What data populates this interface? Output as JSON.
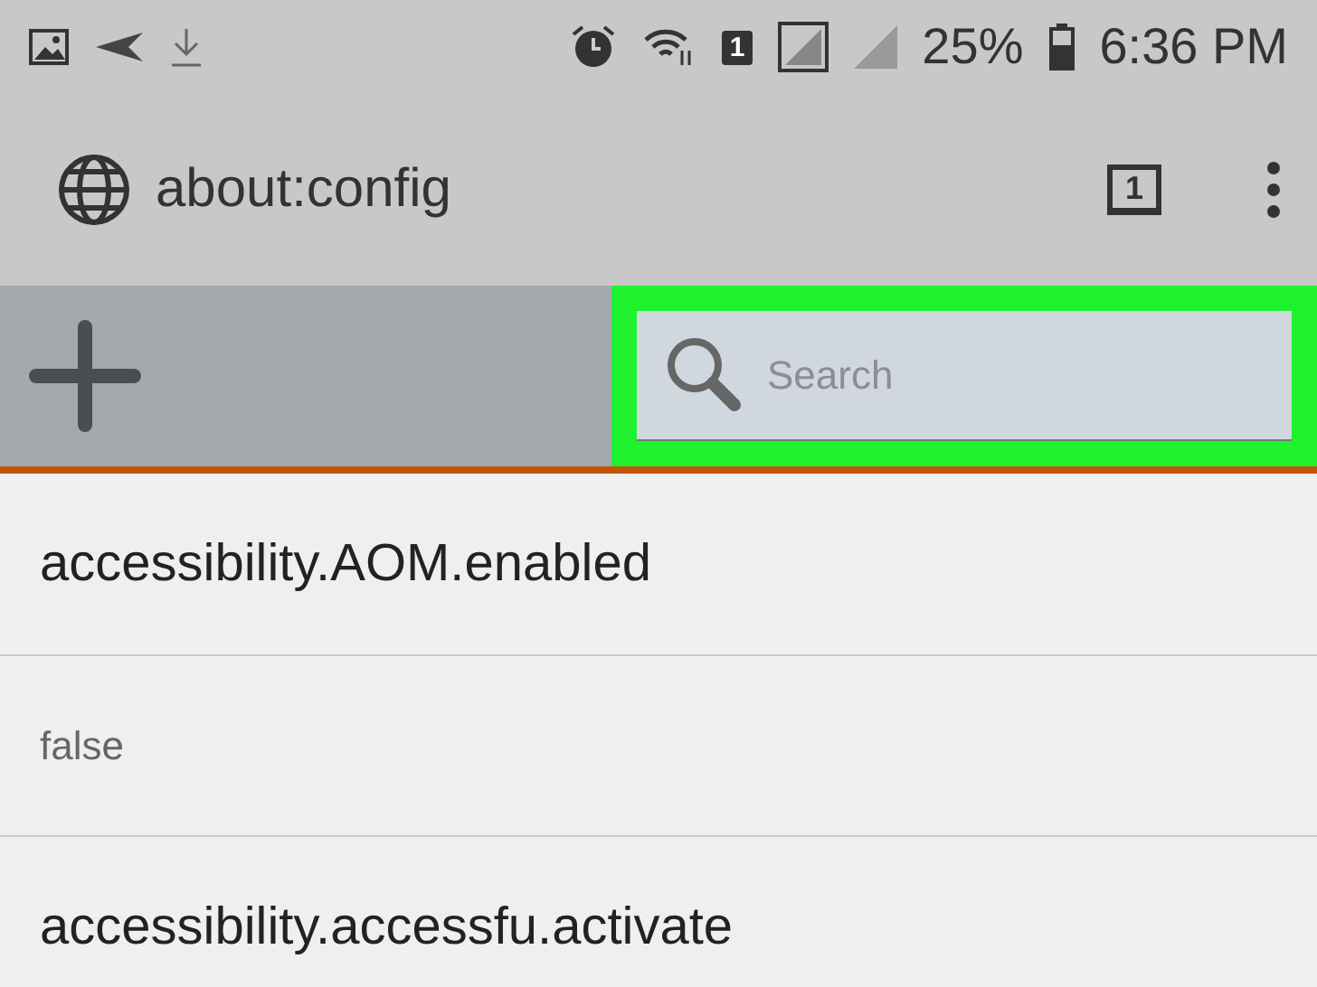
{
  "status_bar": {
    "sim_slot": "1",
    "battery": "25%",
    "time": "6:36 PM"
  },
  "address_bar": {
    "url": "about:config",
    "tab_count": "1"
  },
  "toolbar": {
    "search": {
      "placeholder": "Search",
      "highlighted": true
    }
  },
  "prefs": [
    {
      "name": "accessibility.AOM.enabled",
      "value": "false"
    },
    {
      "name": "accessibility.accessfu.activate"
    }
  ]
}
